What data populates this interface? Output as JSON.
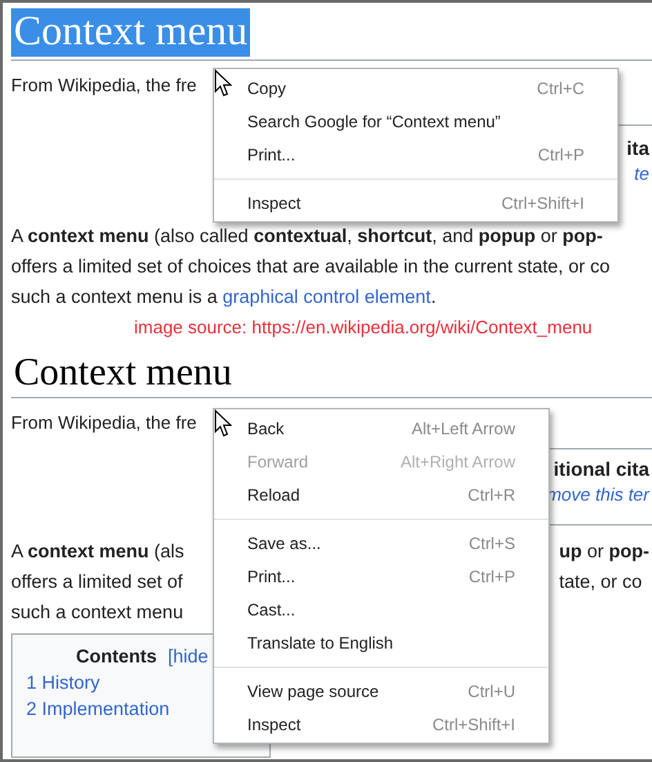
{
  "top_screenshot": {
    "heading": {
      "text": "Context menu",
      "selected": true
    },
    "intro": "From Wikipedia, the fre",
    "infobox": {
      "title": "ita",
      "link": "te"
    },
    "paragraph": {
      "lines": [
        "A **context menu** (also called **contextual**, **shortcut**, and **popup** or **pop-**",
        "offers a limited set of choices that are available in the current state, or co",
        "such a context menu is a "
      ],
      "link": "graphical control element",
      "after_link": "."
    },
    "menu": {
      "items": [
        {
          "kind": "item",
          "label": "Copy",
          "shortcut": "Ctrl+C",
          "disabled": false
        },
        {
          "kind": "item",
          "label": "Search Google for “Context menu”",
          "disabled": false
        },
        {
          "kind": "item",
          "label": "Print...",
          "shortcut": "Ctrl+P",
          "disabled": false
        },
        {
          "kind": "separator"
        },
        {
          "kind": "item",
          "label": "Inspect",
          "shortcut": "Ctrl+Shift+I",
          "disabled": false
        }
      ]
    }
  },
  "caption": "image source: https://en.wikipedia.org/wiki/Context_menu",
  "bottom_screenshot": {
    "heading": {
      "text": "Context menu",
      "selected": false
    },
    "intro": "From Wikipedia, the fre",
    "infobox": {
      "title": "itional cita",
      "link": "move this ter"
    },
    "paragraph_left": [
      "A **context menu** (als",
      "offers a limited set of",
      "such a context menu"
    ],
    "paragraph_right": [
      "**up** or **pop-**",
      "tate, or co"
    ],
    "contents": {
      "title": "Contents",
      "toggle": "[hide",
      "items": [
        {
          "number": "1",
          "label": "History"
        },
        {
          "number": "2",
          "label": "Implementation"
        }
      ]
    },
    "menu": {
      "items": [
        {
          "kind": "item",
          "label": "Back",
          "shortcut": "Alt+Left Arrow",
          "disabled": false
        },
        {
          "kind": "item",
          "label": "Forward",
          "shortcut": "Alt+Right Arrow",
          "disabled": true
        },
        {
          "kind": "item",
          "label": "Reload",
          "shortcut": "Ctrl+R",
          "disabled": false
        },
        {
          "kind": "separator"
        },
        {
          "kind": "item",
          "label": "Save as...",
          "shortcut": "Ctrl+S",
          "disabled": false
        },
        {
          "kind": "item",
          "label": "Print...",
          "shortcut": "Ctrl+P",
          "disabled": false
        },
        {
          "kind": "item",
          "label": "Cast...",
          "disabled": false
        },
        {
          "kind": "item",
          "label": "Translate to English",
          "disabled": false
        },
        {
          "kind": "separator"
        },
        {
          "kind": "item",
          "label": "View page source",
          "shortcut": "Ctrl+U",
          "disabled": false
        },
        {
          "kind": "item",
          "label": "Inspect",
          "shortcut": "Ctrl+Shift+I",
          "disabled": false
        }
      ]
    }
  }
}
